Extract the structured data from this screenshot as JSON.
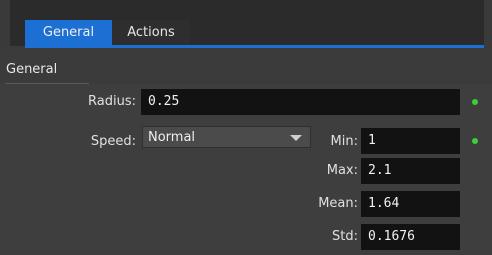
{
  "tabs": [
    {
      "label": "General",
      "active": true
    },
    {
      "label": "Actions",
      "active": false
    }
  ],
  "group": {
    "title": "General"
  },
  "radius": {
    "label": "Radius:",
    "value": "0.25",
    "indicator_color": "#3bcf3b"
  },
  "speed": {
    "label": "Speed:",
    "selected": "Normal",
    "chevron_icon": "chevron-down-icon"
  },
  "min": {
    "label": "Min:",
    "value": "1",
    "indicator_color": "#3bcf3b"
  },
  "max": {
    "label": "Max:",
    "value": "2.1"
  },
  "mean": {
    "label": "Mean:",
    "value": "1.64"
  },
  "std": {
    "label": "Std:",
    "value": "0.1676"
  },
  "colors": {
    "accent": "#1c6fd3",
    "field_bg": "#121212",
    "panel_bg": "#3e3e3e"
  }
}
